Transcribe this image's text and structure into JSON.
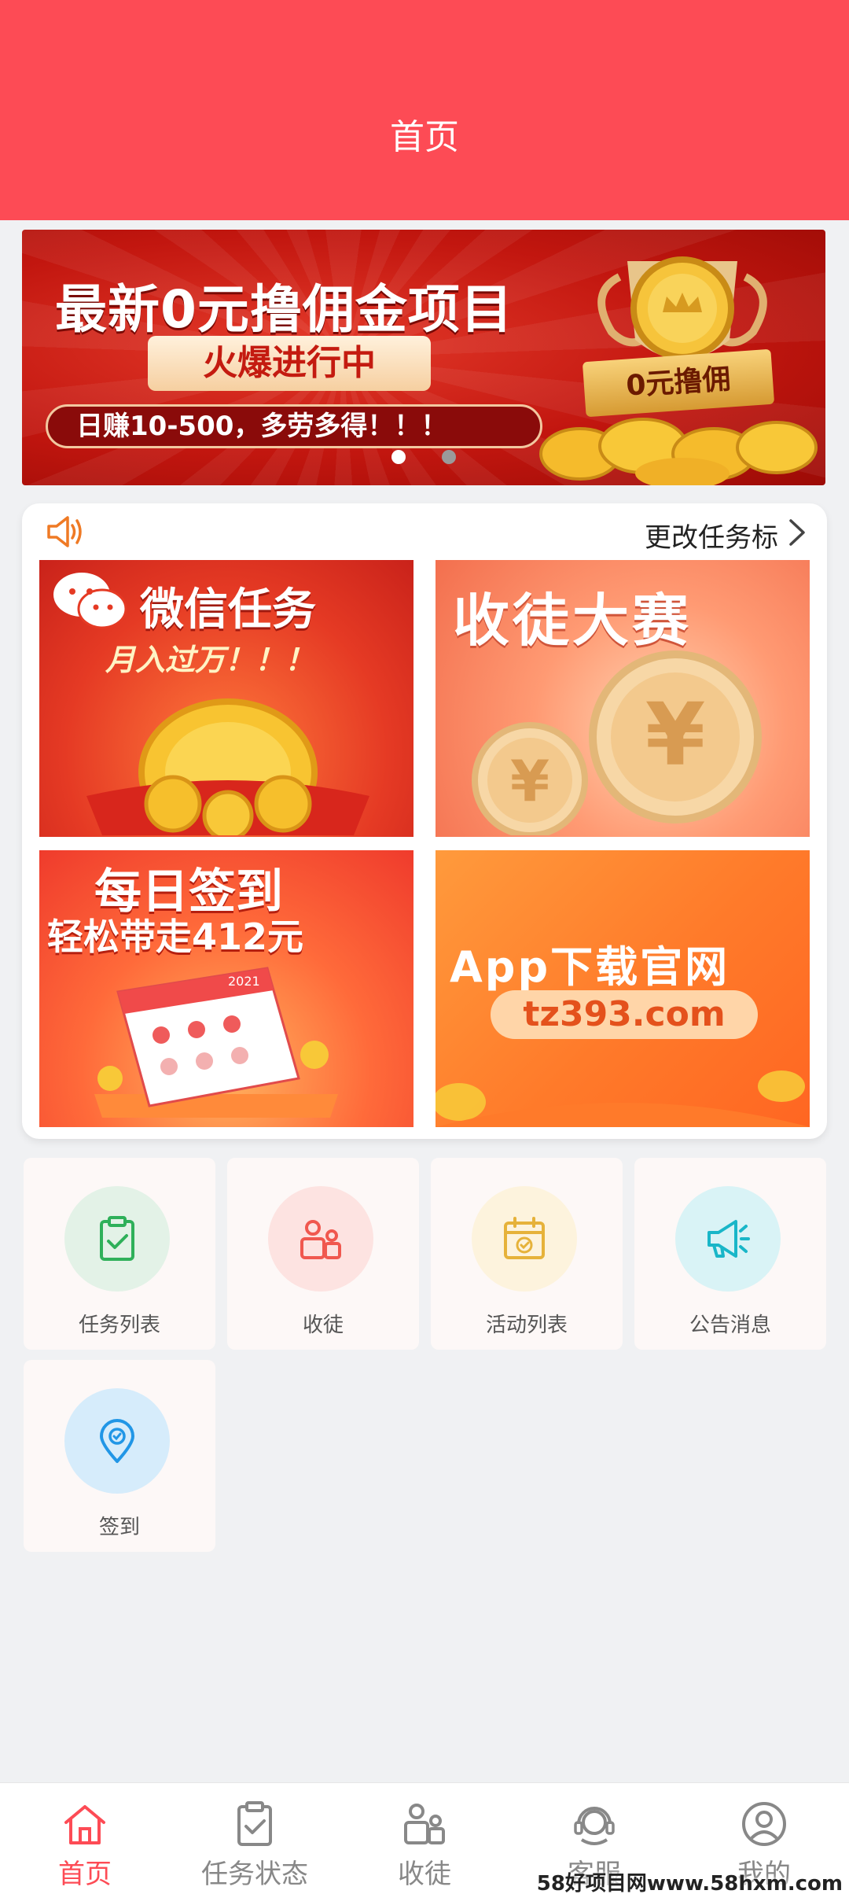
{
  "header": {
    "title": "首页"
  },
  "banner": {
    "title": "最新0元撸佣金项目",
    "subtitle": "火爆进行中",
    "line": "日赚10-500，多劳多得！！！",
    "trophy_ribbon": "0元撸佣",
    "dots": 2,
    "active_dot": 0
  },
  "notice": {
    "text": "更改任务标",
    "icon": "speaker-icon"
  },
  "tiles": [
    {
      "title": "微信任务",
      "subtitle": "月入过万！！！"
    },
    {
      "title": "收徒大赛"
    },
    {
      "title": "每日签到",
      "subtitle": "轻松带走412元",
      "year": "2021"
    },
    {
      "title": "App下载官网",
      "subtitle": "tz393.com"
    }
  ],
  "grid": [
    {
      "label": "任务列表",
      "icon": "clipboard-check-icon",
      "color": "#2fb05a",
      "bg": "#e3f2e7"
    },
    {
      "label": "收徒",
      "icon": "users-icon",
      "color": "#f0584f",
      "bg": "#fde3e1"
    },
    {
      "label": "活动列表",
      "icon": "calendar-icon",
      "color": "#e6b23a",
      "bg": "#fdf3dd"
    },
    {
      "label": "公告消息",
      "icon": "megaphone-icon",
      "color": "#19b6c8",
      "bg": "#d9f3f6"
    },
    {
      "label": "签到",
      "icon": "location-pin-icon",
      "color": "#2196e6",
      "bg": "#d6ecfb"
    }
  ],
  "tabbar": [
    {
      "label": "首页",
      "icon": "home-icon",
      "active": true
    },
    {
      "label": "任务状态",
      "icon": "clipboard-check-icon"
    },
    {
      "label": "收徒",
      "icon": "users-icon"
    },
    {
      "label": "客服",
      "icon": "headset-icon"
    },
    {
      "label": "我的",
      "icon": "user-circle-icon"
    }
  ],
  "watermark": "58好项目网www.58hxm.com",
  "colors": {
    "primary": "#fd4b55",
    "background": "#f0f1f3"
  }
}
